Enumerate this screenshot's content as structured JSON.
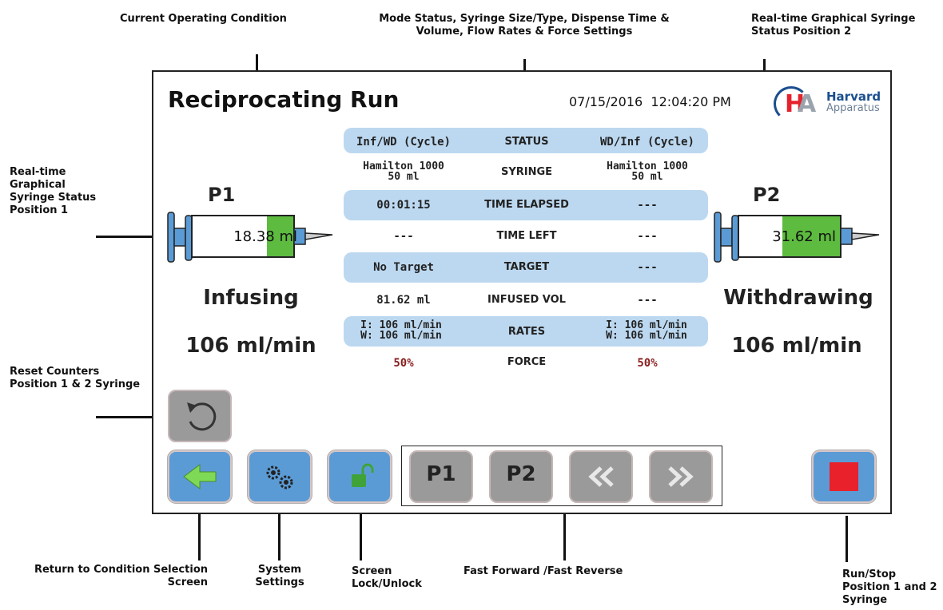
{
  "annotations": {
    "current_condition": "Current Operating Condition",
    "mode_status_1": "Mode Status, Syringe Size/Type, Dispense Time &",
    "mode_status_2": "Volume, Flow Rates & Force Settings",
    "realtime_p2_1": "Real-time Graphical Syringe",
    "realtime_p2_2": "Status Position 2",
    "realtime_p1_1": "Real-time",
    "realtime_p1_2": "Graphical",
    "realtime_p1_3": "Syringe Status",
    "realtime_p1_4": "Position 1",
    "reset_1": "Reset Counters",
    "reset_2": "Position 1 & 2 Syringe",
    "return_1": "Return to Condition Selection",
    "return_2": "Screen",
    "system_1": "System",
    "system_2": "Settings",
    "lock_1": "Screen",
    "lock_2": "Lock/Unlock",
    "ff": "Fast Forward /Fast Reverse",
    "run_1": "Run/Stop",
    "run_2": "Position 1 and 2",
    "run_3": "Syringe"
  },
  "header": {
    "title": "Reciprocating Run",
    "date": "07/15/2016",
    "time": "12:04:20 PM"
  },
  "logo": {
    "letter_h": "H",
    "letter_a": "A",
    "line1": "Harvard",
    "line2": "Apparatus"
  },
  "status_table": {
    "rows": [
      {
        "left": "Inf/WD (Cycle)",
        "label": "STATUS",
        "right": "WD/Inf (Cycle)"
      },
      {
        "left_1": "Hamilton 1000",
        "left_2": "50 ml",
        "label": "SYRINGE",
        "right_1": "Hamilton 1000",
        "right_2": "50 ml"
      },
      {
        "left": "00:01:15",
        "label": "TIME ELAPSED",
        "right": "---"
      },
      {
        "left": "---",
        "label": "TIME LEFT",
        "right": "---"
      },
      {
        "left": "No Target",
        "label": "TARGET",
        "right": "---"
      },
      {
        "left": "81.62 ml",
        "label": "INFUSED VOL",
        "right": "---"
      },
      {
        "left_1": "I: 106 ml/min",
        "left_2": "W: 106 ml/min",
        "label": "RATES",
        "right_1": "I: 106 ml/min",
        "right_2": "W: 106 ml/min"
      },
      {
        "left": "50%",
        "label": "FORCE",
        "right": "50%"
      }
    ]
  },
  "syringe_p1": {
    "label": "P1",
    "volume": "18.38",
    "unit": "ml",
    "fill_fraction": 0.26,
    "state": "Infusing",
    "rate": "106 ml/min"
  },
  "syringe_p2": {
    "label": "P2",
    "volume": "31.62",
    "unit": "ml",
    "fill_fraction": 0.57,
    "state": "Withdrawing",
    "rate": "106 ml/min"
  },
  "buttons": {
    "p1": "P1",
    "p2": "P2"
  },
  "colors": {
    "stripe": "#bcd8f0",
    "button_blue": "#5b9bd5",
    "button_gray": "#9a9a9a",
    "syringe_fill": "#5dbb3f",
    "stop_red": "#e8212a"
  }
}
